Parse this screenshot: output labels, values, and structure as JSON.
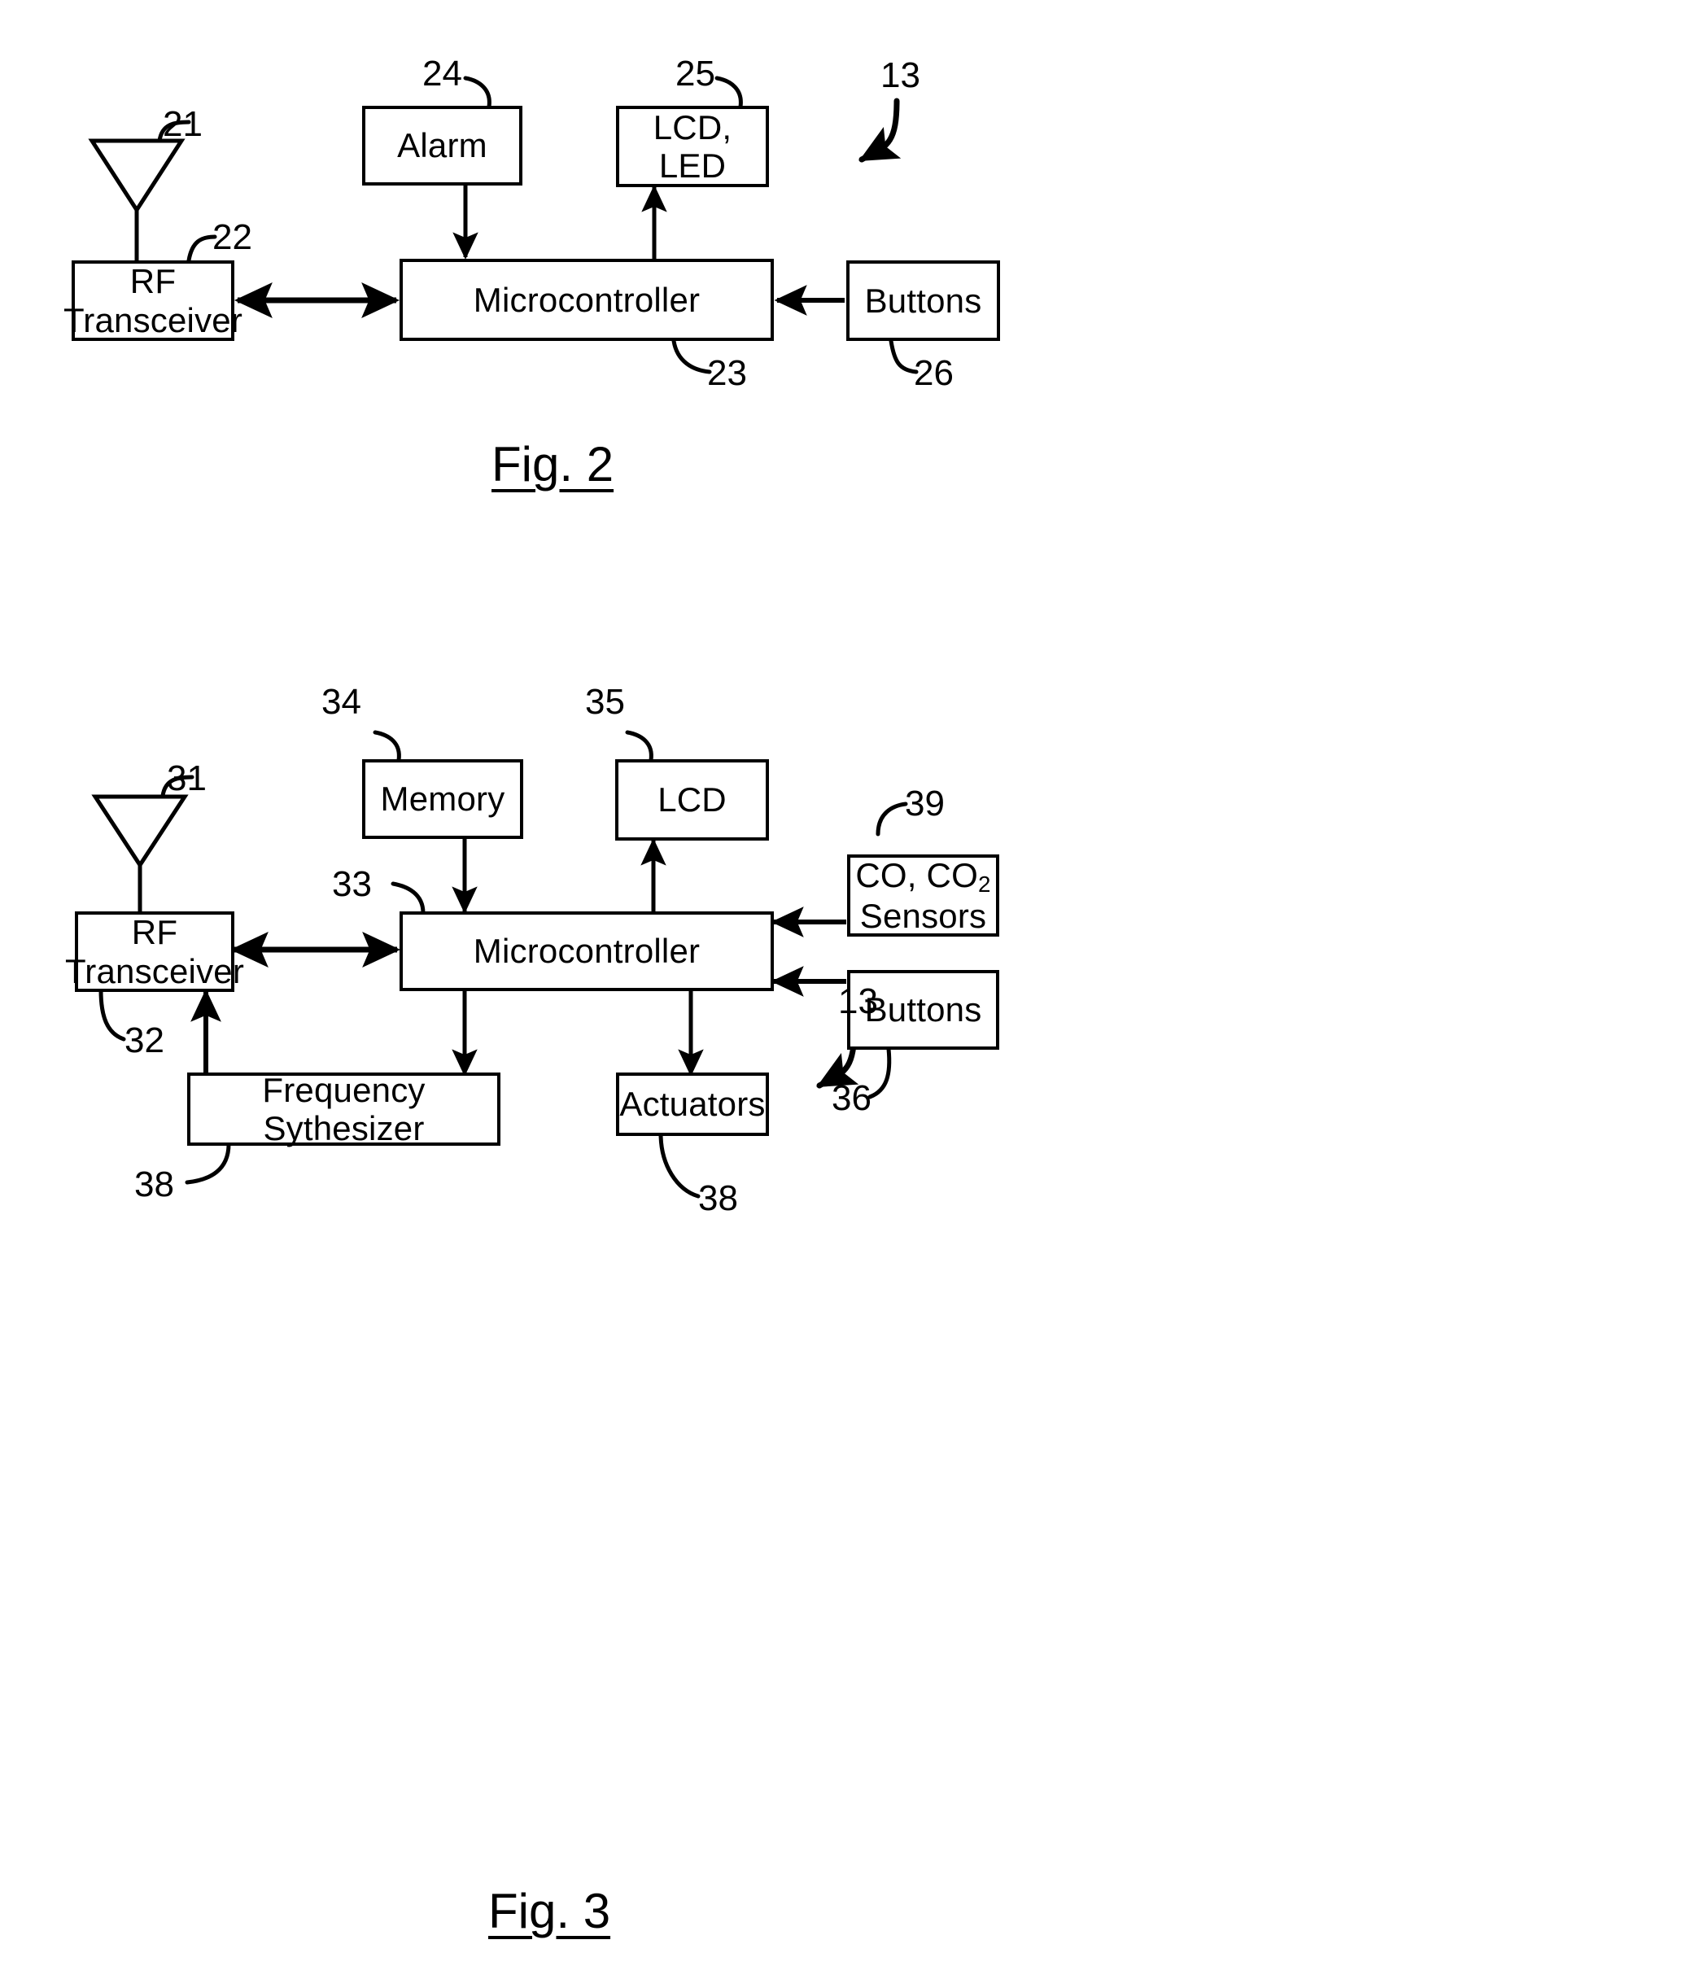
{
  "document": {
    "type": "patent-figure-sheet",
    "figures": [
      {
        "id": "fig2",
        "caption": "Fig. 2",
        "assembly_ref": "13",
        "blocks": [
          {
            "key": "alarm",
            "label": "Alarm",
            "ref": "24"
          },
          {
            "key": "lcd_led",
            "label": "LCD, LED",
            "ref": "25"
          },
          {
            "key": "rf_transceiver",
            "label": "RF\nTransceiver",
            "ref": "22"
          },
          {
            "key": "microcontroller",
            "label": "Microcontroller",
            "ref": "23"
          },
          {
            "key": "buttons",
            "label": "Buttons",
            "ref": "26"
          },
          {
            "key": "antenna",
            "label": "",
            "ref": "21"
          }
        ],
        "connections": [
          {
            "from": "alarm",
            "to": "microcontroller",
            "arrow": "single-down"
          },
          {
            "from": "microcontroller",
            "to": "lcd_led",
            "arrow": "single-up"
          },
          {
            "from": "rf_transceiver",
            "to": "microcontroller",
            "arrow": "double"
          },
          {
            "from": "buttons",
            "to": "microcontroller",
            "arrow": "single-left"
          },
          {
            "from": "antenna",
            "to": "rf_transceiver",
            "arrow": "plain-line"
          }
        ]
      },
      {
        "id": "fig3",
        "caption": "Fig. 3",
        "assembly_ref": "13",
        "blocks": [
          {
            "key": "memory",
            "label": "Memory",
            "ref": "34"
          },
          {
            "key": "lcd",
            "label": "LCD",
            "ref": "35"
          },
          {
            "key": "co_sensors",
            "label": "CO, CO2\nSensors",
            "ref": "39"
          },
          {
            "key": "rf_transceiver",
            "label": "RF\nTransceiver",
            "ref": "32"
          },
          {
            "key": "microcontroller",
            "label": "Microcontroller",
            "ref": "33"
          },
          {
            "key": "buttons",
            "label": "Buttons",
            "ref": "36"
          },
          {
            "key": "freq_synth",
            "label": "Frequency Sythesizer",
            "ref": "38"
          },
          {
            "key": "actuators",
            "label": "Actuators",
            "ref": "38"
          },
          {
            "key": "antenna",
            "label": "",
            "ref": "31"
          }
        ],
        "connections": [
          {
            "from": "memory",
            "to": "microcontroller",
            "arrow": "single-down"
          },
          {
            "from": "microcontroller",
            "to": "lcd",
            "arrow": "single-up"
          },
          {
            "from": "rf_transceiver",
            "to": "microcontroller",
            "arrow": "double"
          },
          {
            "from": "co_sensors",
            "to": "microcontroller",
            "arrow": "single-left"
          },
          {
            "from": "buttons",
            "to": "microcontroller",
            "arrow": "single-left"
          },
          {
            "from": "microcontroller",
            "to": "freq_synth",
            "arrow": "single-down"
          },
          {
            "from": "microcontroller",
            "to": "actuators",
            "arrow": "single-down"
          },
          {
            "from": "freq_synth",
            "to": "rf_transceiver",
            "arrow": "single-up"
          },
          {
            "from": "antenna",
            "to": "rf_transceiver",
            "arrow": "plain-line"
          }
        ]
      }
    ]
  },
  "fig2": {
    "caption": "Fig. 2",
    "assembly_ref": "13",
    "alarm": {
      "label": "Alarm",
      "ref": "24"
    },
    "lcd_led": {
      "label": "LCD, LED",
      "ref": "25"
    },
    "rf_transceiver": {
      "line1": "RF",
      "line2": "Transceiver",
      "ref": "22"
    },
    "microcontroller": {
      "label": "Microcontroller",
      "ref": "23"
    },
    "buttons": {
      "label": "Buttons",
      "ref": "26"
    },
    "antenna": {
      "ref": "21"
    }
  },
  "fig3": {
    "caption": "Fig. 3",
    "assembly_ref": "13",
    "memory": {
      "label": "Memory",
      "ref": "34"
    },
    "lcd": {
      "label": "LCD",
      "ref": "35"
    },
    "co_sensors": {
      "line1": "CO, CO",
      "sub": "2",
      "line2": "Sensors",
      "ref": "39"
    },
    "rf_transceiver": {
      "line1": "RF",
      "line2": "Transceiver",
      "ref": "32"
    },
    "microcontroller": {
      "label": "Microcontroller",
      "ref": "33"
    },
    "buttons": {
      "label": "Buttons",
      "ref": "36"
    },
    "freq_synth": {
      "label": "Frequency Sythesizer",
      "ref": "38"
    },
    "actuators": {
      "label": "Actuators",
      "ref": "38"
    },
    "antenna": {
      "ref": "31"
    }
  },
  "colors": {
    "ink": "#000000",
    "paper": "#ffffff"
  }
}
